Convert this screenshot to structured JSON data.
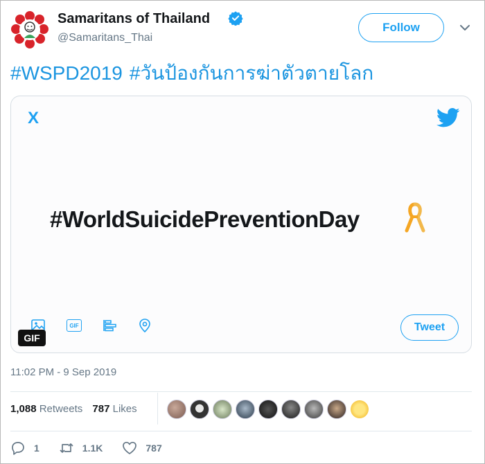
{
  "user": {
    "display_name": "Samaritans of Thailand",
    "handle": "@Samaritans_Thai",
    "verified": true,
    "avatar_icon": "samaritans-logo"
  },
  "follow_label": "Follow",
  "tweet_text": [
    "#WSPD2019",
    "#วันป้องกันการฆ่าตัวตายโลก"
  ],
  "media": {
    "close_label": "X",
    "headline": "#WorldSuicidePreventionDay",
    "ribbon_color": "#f5a623",
    "gif_label": "GIF",
    "compose_gif_label": "GIF",
    "tweet_button_label": "Tweet"
  },
  "timestamp": "11:02 PM - 9 Sep 2019",
  "stats": {
    "retweets_count": "1,088",
    "retweets_label": "Retweets",
    "likes_count": "787",
    "likes_label": "Likes"
  },
  "actions": {
    "reply_count": "1",
    "retweet_count": "1.1K",
    "like_count": "787"
  },
  "colors": {
    "accent": "#1da1f2",
    "hashtag": "#1b95e0",
    "muted": "#657786"
  }
}
